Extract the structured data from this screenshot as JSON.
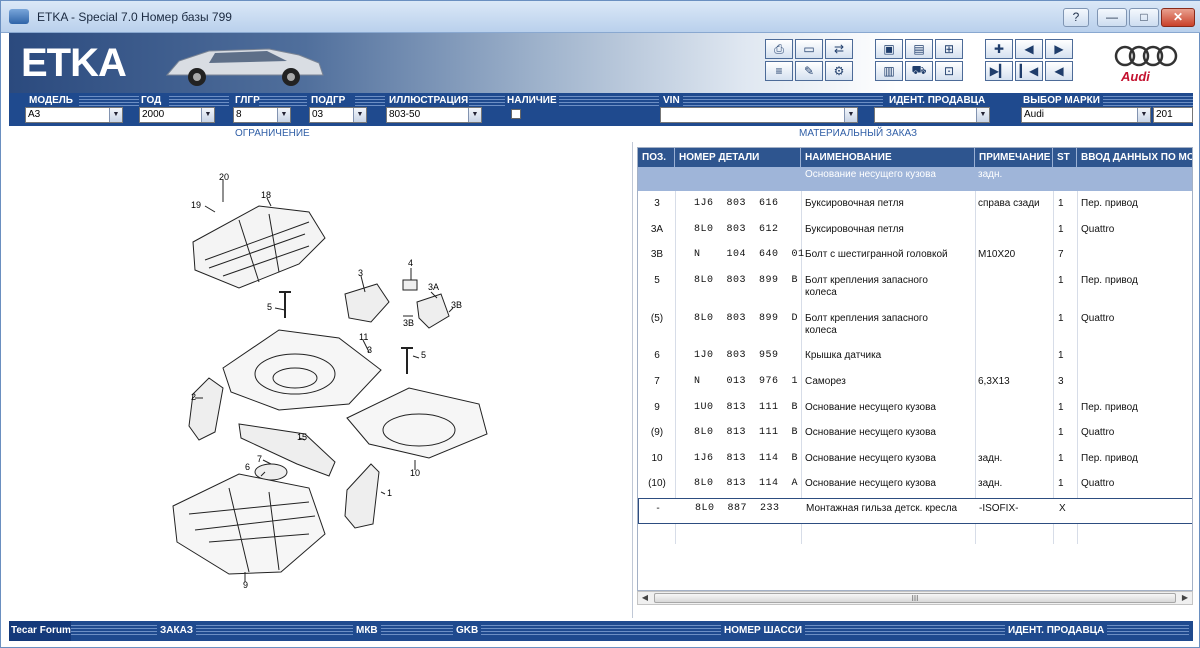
{
  "window": {
    "title": "ETKA - Special 7.0 Номер базы 799",
    "help": "?",
    "minimize": "—",
    "maximize": "□",
    "close": "✕"
  },
  "banner": {
    "logo": "ETKA",
    "brand_wordmark": "Audi"
  },
  "selectors": {
    "model_label": "МОДЕЛЬ",
    "model_value": "A3",
    "year_label": "ГОД",
    "year_value": "2000",
    "mg_label": "ГЛГР",
    "mg_value": "8",
    "sg_label": "ПОДГР",
    "sg_value": "03",
    "illus_label": "ИЛЛЮСТРАЦИЯ",
    "illus_value": "803-50",
    "stock_label": "НАЛИЧИЕ",
    "vin_label": "VIN",
    "vin_value": "",
    "dealer_label": "ИДЕНТ. ПРОДАВЦА",
    "dealer_value": "",
    "brand_label": "ВЫБОР МАРКИ",
    "brand_value": "Audi",
    "extra_value": "201",
    "arrow": "▼"
  },
  "sections": {
    "left": "ОГРАНИЧЕНИЕ",
    "right": "МАТЕРИАЛЬНЫЙ ЗАКАЗ"
  },
  "table": {
    "columns": [
      "ПОЗ.",
      "НОМЕР ДЕТАЛИ",
      "НАИМЕНОВАНИЕ",
      "ПРИМЕЧАНИЕ",
      "ST",
      "ВВОД ДАННЫХ ПО МО"
    ],
    "subheader": {
      "name": "Основание несущего кузова",
      "note": "задн."
    },
    "rows": [
      {
        "pos": "3",
        "part": "1J6  803  616",
        "name": "Буксировочная петля",
        "name2": "",
        "note": "справа сзади",
        "qty": "1",
        "info": "Пер. привод"
      },
      {
        "pos": "3A",
        "part": "8L0  803  612",
        "name": "Буксировочная петля",
        "name2": "",
        "note": "",
        "qty": "1",
        "info": "Quattro"
      },
      {
        "pos": "3B",
        "part": "N    104  640  01",
        "name": "Болт с шестигранной головкой",
        "name2": "",
        "note": "M10X20",
        "qty": "7",
        "info": ""
      },
      {
        "pos": "5",
        "part": "8L0  803  899  B",
        "name": "Болт крепления запасного",
        "name2": "колеса",
        "note": "",
        "qty": "1",
        "info": "Пер. привод"
      },
      {
        "pos": "(5)",
        "part": "8L0  803  899  D",
        "name": "Болт крепления запасного",
        "name2": "колеса",
        "note": "",
        "qty": "1",
        "info": "Quattro"
      },
      {
        "pos": "6",
        "part": "1J0  803  959",
        "name": "Крышка датчика",
        "name2": "",
        "note": "",
        "qty": "1",
        "info": ""
      },
      {
        "pos": "7",
        "part": "N    013  976  1",
        "name": "Саморез",
        "name2": "",
        "note": "6,3X13",
        "qty": "3",
        "info": ""
      },
      {
        "pos": "9",
        "part": "1U0  813  111  B",
        "name": "Основание несущего кузова",
        "name2": "",
        "note": "",
        "qty": "1",
        "info": "Пер. привод"
      },
      {
        "pos": "(9)",
        "part": "8L0  813  111  B",
        "name": "Основание несущего кузова",
        "name2": "",
        "note": "",
        "qty": "1",
        "info": "Quattro"
      },
      {
        "pos": "10",
        "part": "1J6  813  114  B",
        "name": "Основание несущего кузова",
        "name2": "",
        "note": "задн.",
        "qty": "1",
        "info": "Пер. привод"
      },
      {
        "pos": "(10)",
        "part": "8L0  813  114  A",
        "name": "Основание несущего кузова",
        "name2": "",
        "note": "задн.",
        "qty": "1",
        "info": "Quattro"
      },
      {
        "pos": "-",
        "part": "8L0  887  233",
        "name": "Монтажная гильза детск. кресла",
        "name2": "",
        "note": "-ISOFIX-",
        "qty": "X",
        "info": ""
      }
    ],
    "scroll_left": "◀",
    "scroll_right": "▶",
    "scroll_grip": "III"
  },
  "callouts": [
    "20",
    "18",
    "19",
    "3",
    "4",
    "3A",
    "3B",
    "3B",
    "5",
    "11",
    "3",
    "5",
    "2",
    "15",
    "7",
    "6",
    "10",
    "1",
    "9"
  ],
  "bottom": {
    "forum": "Tecar Forum",
    "order": "ЗАКАЗ",
    "mkb": "МКВ",
    "gkb": "GKB",
    "chassis": "НОМЕР ШАССИ",
    "dealer": "ИДЕНТ. ПРОДАВЦА"
  }
}
